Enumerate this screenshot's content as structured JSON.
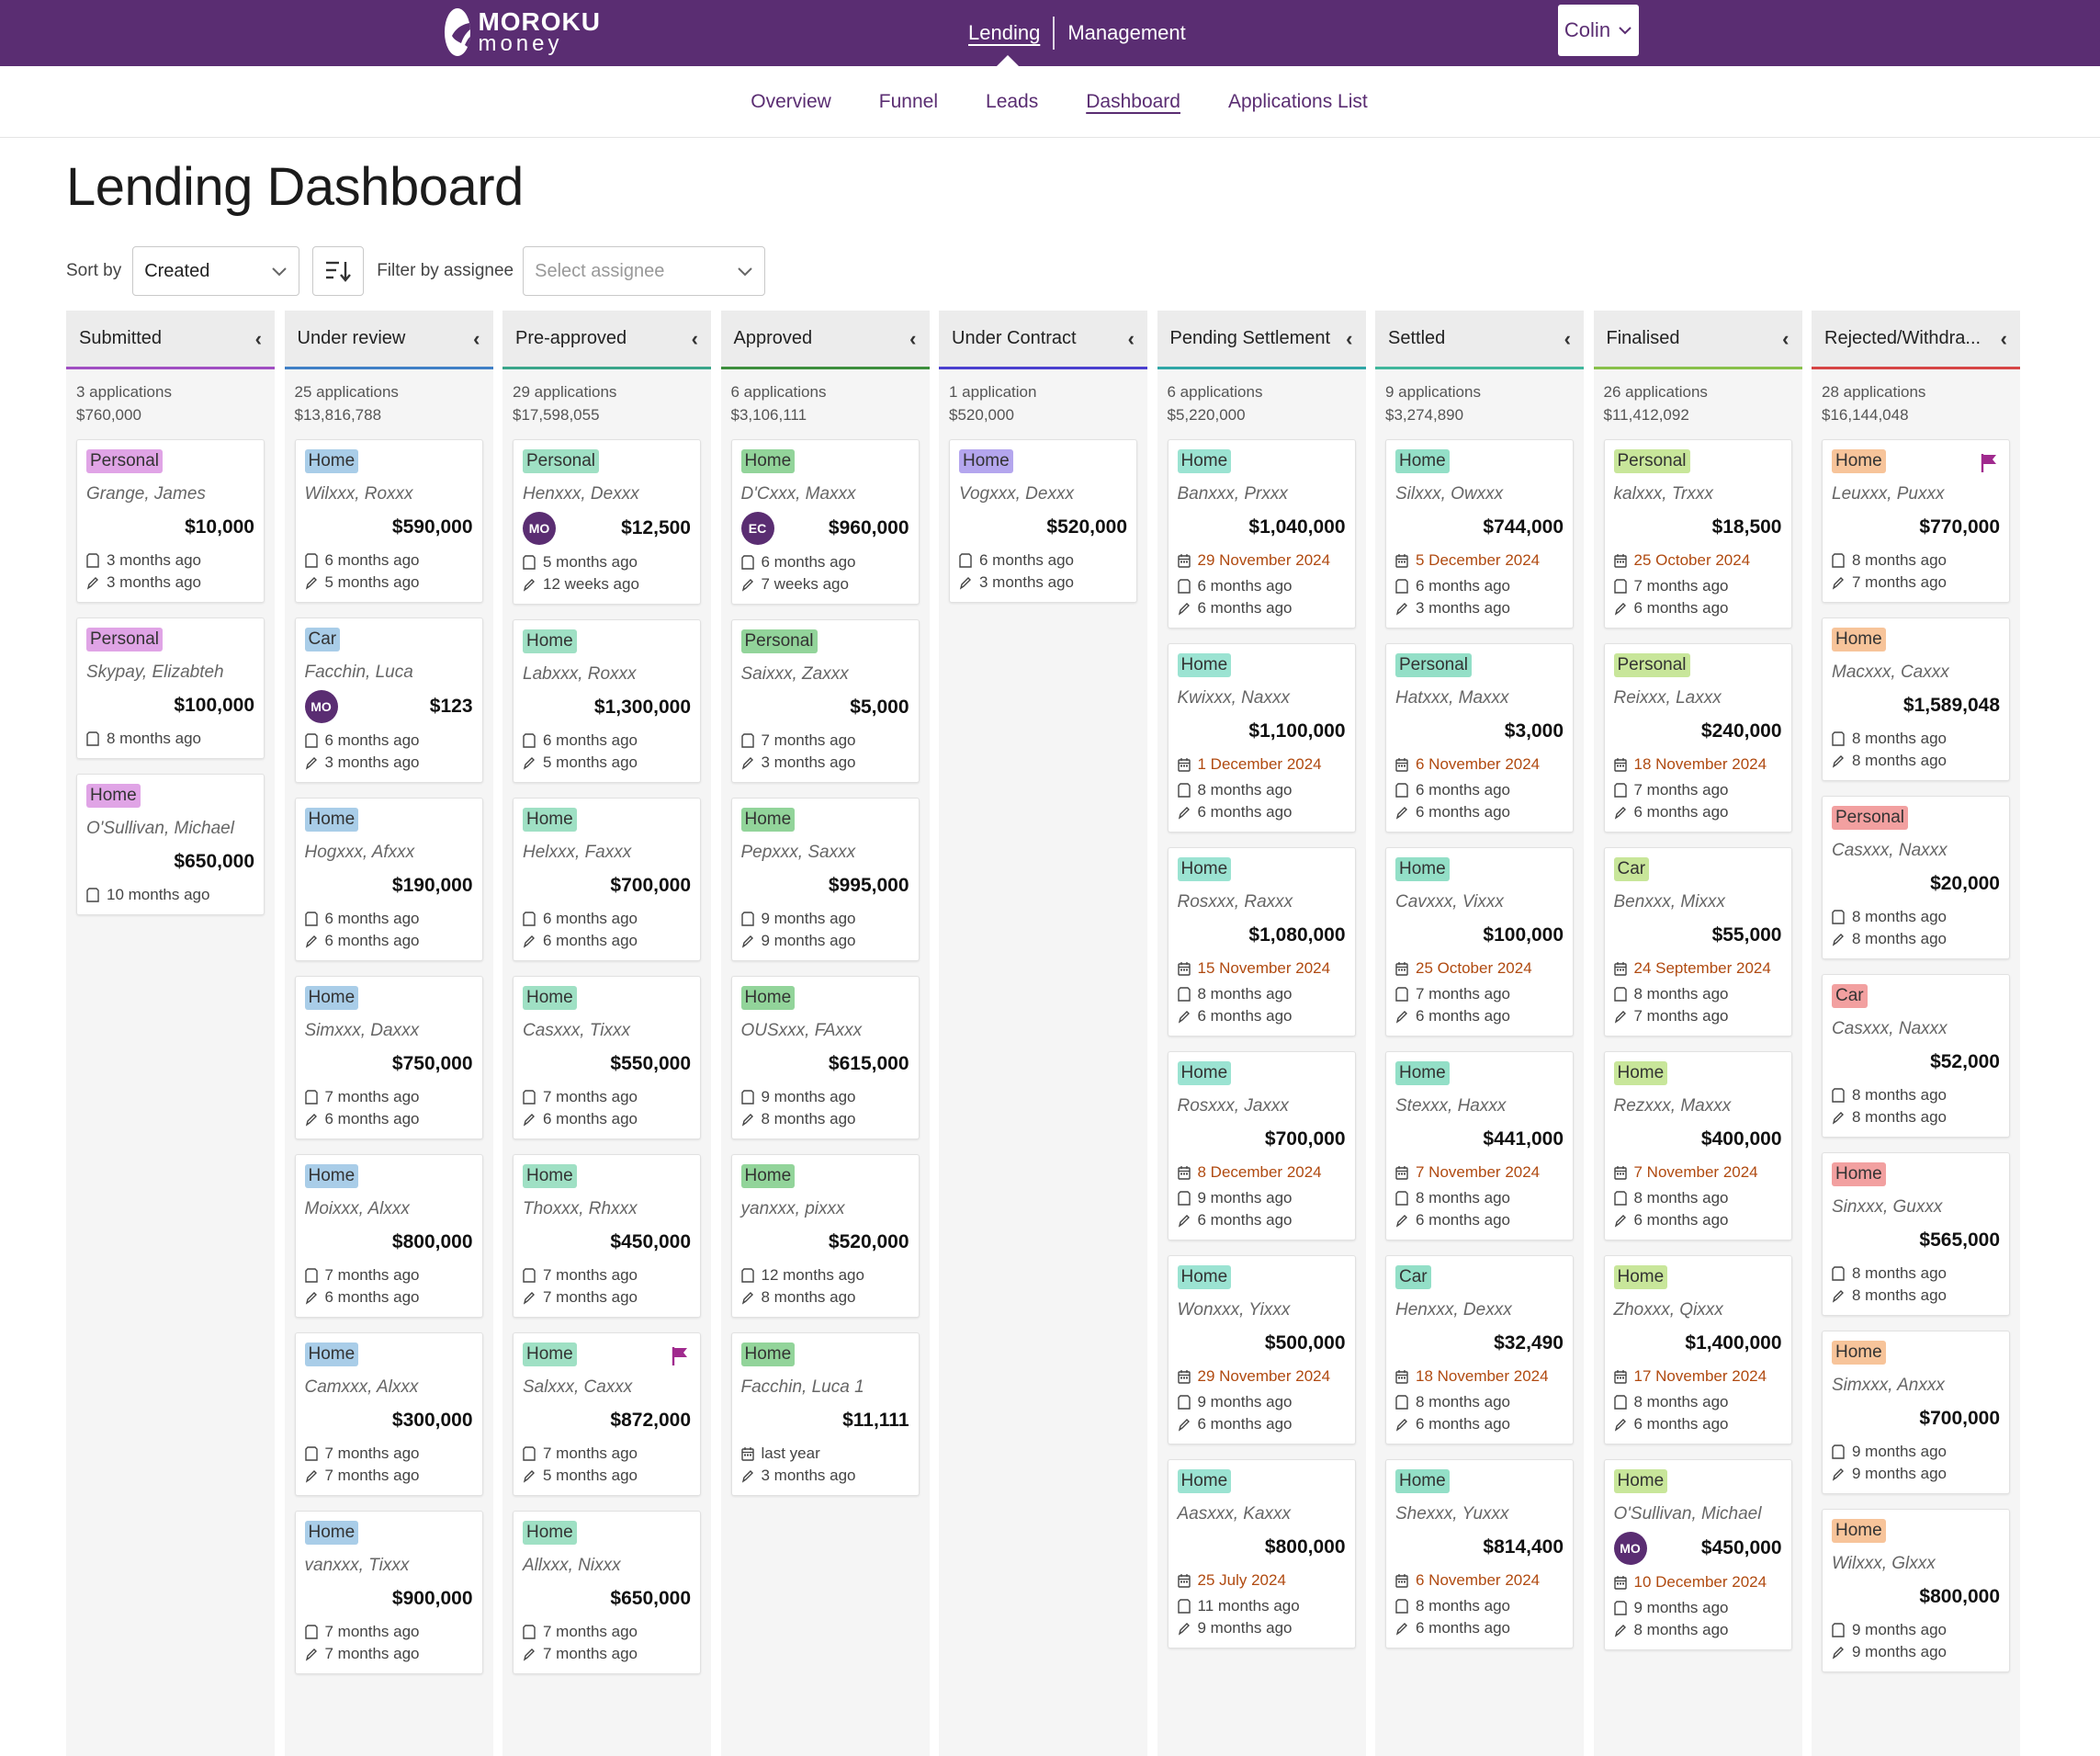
{
  "brand": {
    "line1": "MOROKU",
    "line2": "money"
  },
  "topnav": {
    "lending": "Lending",
    "management": "Management"
  },
  "user": {
    "name": "Colin"
  },
  "subnav": [
    {
      "label": "Overview",
      "active": false
    },
    {
      "label": "Funnel",
      "active": false
    },
    {
      "label": "Leads",
      "active": false
    },
    {
      "label": "Dashboard",
      "active": true
    },
    {
      "label": "Applications List",
      "active": false
    }
  ],
  "page": {
    "title": "Lending Dashboard"
  },
  "controls": {
    "sort_label": "Sort by",
    "sort_value": "Created",
    "filter_label": "Filter by assignee",
    "filter_placeholder": "Select assignee"
  },
  "colors": {
    "brand": "#5a2d72",
    "date_due": "#b04a10"
  },
  "columns": [
    {
      "title": "Submitted",
      "count": "3 applications",
      "total": "$760,000",
      "color": "#a04ec2",
      "cards": [
        {
          "tag": "Personal",
          "tag_color": "#e0a4e6",
          "name": "Grange, James",
          "amount": "$10,000",
          "created": "3 months ago",
          "edited": "3 months ago"
        },
        {
          "tag": "Personal",
          "tag_color": "#e0a4e6",
          "name": "Skypay, Elizabteh",
          "amount": "$100,000",
          "created": "8 months ago"
        },
        {
          "tag": "Home",
          "tag_color": "#e0a4e6",
          "name": "O'Sullivan, Michael",
          "amount": "$650,000",
          "created": "10 months ago"
        }
      ]
    },
    {
      "title": "Under review",
      "count": "25 applications",
      "total": "$13,816,788",
      "color": "#3f7fc6",
      "cards": [
        {
          "tag": "Home",
          "tag_color": "#a9cde8",
          "name": "Wilxxx, Roxxx",
          "amount": "$590,000",
          "created": "6 months ago",
          "edited": "5 months ago"
        },
        {
          "tag": "Car",
          "tag_color": "#a9cde8",
          "name": "Facchin, Luca",
          "avatar": "MO",
          "amount": "$123",
          "created": "6 months ago",
          "edited": "3 months ago"
        },
        {
          "tag": "Home",
          "tag_color": "#a9cde8",
          "name": "Hogxxx, Afxxx",
          "amount": "$190,000",
          "created": "6 months ago",
          "edited": "6 months ago"
        },
        {
          "tag": "Home",
          "tag_color": "#a9cde8",
          "name": "Simxxx, Daxxx",
          "amount": "$750,000",
          "created": "7 months ago",
          "edited": "6 months ago"
        },
        {
          "tag": "Home",
          "tag_color": "#a9cde8",
          "name": "Moixxx, Alxxx",
          "amount": "$800,000",
          "created": "7 months ago",
          "edited": "6 months ago"
        },
        {
          "tag": "Home",
          "tag_color": "#a9cde8",
          "name": "Camxxx, Alxxx",
          "amount": "$300,000",
          "created": "7 months ago",
          "edited": "7 months ago"
        },
        {
          "tag": "Home",
          "tag_color": "#a9cde8",
          "name": "vanxxx, Tixxx",
          "amount": "$900,000",
          "created": "7 months ago",
          "edited": "7 months ago"
        }
      ]
    },
    {
      "title": "Pre-approved",
      "count": "29 applications",
      "total": "$17,598,055",
      "color": "#3aa58a",
      "cards": [
        {
          "tag": "Personal",
          "tag_color": "#9fe0c4",
          "name": "Henxxx, Dexxx",
          "avatar": "MO",
          "amount": "$12,500",
          "created": "5 months ago",
          "edited": "12 weeks ago"
        },
        {
          "tag": "Home",
          "tag_color": "#9fe0c4",
          "name": "Labxxx, Roxxx",
          "amount": "$1,300,000",
          "created": "6 months ago",
          "edited": "5 months ago"
        },
        {
          "tag": "Home",
          "tag_color": "#9fe0c4",
          "name": "Helxxx, Faxxx",
          "amount": "$700,000",
          "created": "6 months ago",
          "edited": "6 months ago"
        },
        {
          "tag": "Home",
          "tag_color": "#9fe0c4",
          "name": "Casxxx, Tixxx",
          "amount": "$550,000",
          "created": "7 months ago",
          "edited": "6 months ago"
        },
        {
          "tag": "Home",
          "tag_color": "#9fe0c4",
          "name": "Thoxxx, Rhxxx",
          "amount": "$450,000",
          "created": "7 months ago",
          "edited": "7 months ago"
        },
        {
          "tag": "Home",
          "tag_color": "#9fe0c4",
          "name": "Salxxx, Caxxx",
          "amount": "$872,000",
          "created": "7 months ago",
          "edited": "5 months ago",
          "flag": true
        },
        {
          "tag": "Home",
          "tag_color": "#9fe0c4",
          "name": "Allxxx, Nixxx",
          "amount": "$650,000",
          "created": "7 months ago",
          "edited": "7 months ago"
        }
      ]
    },
    {
      "title": "Approved",
      "count": "6 applications",
      "total": "$3,106,111",
      "color": "#3c8e3c",
      "cards": [
        {
          "tag": "Home",
          "tag_color": "#92d49a",
          "name": "D'Cxxx, Maxxx",
          "avatar": "EC",
          "amount": "$960,000",
          "created": "6 months ago",
          "edited": "7 weeks ago"
        },
        {
          "tag": "Personal",
          "tag_color": "#92d49a",
          "name": "Saixxx, Zaxxx",
          "amount": "$5,000",
          "created": "7 months ago",
          "edited": "3 months ago"
        },
        {
          "tag": "Home",
          "tag_color": "#92d49a",
          "name": "Pepxxx, Saxxx",
          "amount": "$995,000",
          "created": "9 months ago",
          "edited": "9 months ago"
        },
        {
          "tag": "Home",
          "tag_color": "#92d49a",
          "name": "OUSxxx, FAxxx",
          "amount": "$615,000",
          "created": "9 months ago",
          "edited": "8 months ago"
        },
        {
          "tag": "Home",
          "tag_color": "#92d49a",
          "name": "yanxxx, pixxx",
          "amount": "$520,000",
          "created": "12 months ago",
          "edited": "8 months ago"
        },
        {
          "tag": "Home",
          "tag_color": "#92d49a",
          "name": "Facchin, Luca 1",
          "amount": "$11,111",
          "created": "last year",
          "edited": "3 months ago",
          "created_icon": "calendar"
        }
      ]
    },
    {
      "title": "Under Contract",
      "count": "1 application",
      "total": "$520,000",
      "color": "#4a3fcf",
      "cards": [
        {
          "tag": "Home",
          "tag_color": "#b4a6ee",
          "name": "Vogxxx, Dexxx",
          "amount": "$520,000",
          "created": "6 months ago",
          "edited": "3 months ago"
        }
      ]
    },
    {
      "title": "Pending Settlement",
      "count": "6 applications",
      "total": "$5,220,000",
      "color": "#2fa6a6",
      "cards": [
        {
          "tag": "Home",
          "tag_color": "#9be3d2",
          "name": "Banxxx, Prxxx",
          "amount": "$1,040,000",
          "date": "29 November 2024",
          "created": "6 months ago",
          "edited": "6 months ago"
        },
        {
          "tag": "Home",
          "tag_color": "#9be3d2",
          "name": "Kwixxx, Naxxx",
          "amount": "$1,100,000",
          "date": "1 December 2024",
          "created": "8 months ago",
          "edited": "6 months ago"
        },
        {
          "tag": "Home",
          "tag_color": "#9be3d2",
          "name": "Rosxxx, Raxxx",
          "amount": "$1,080,000",
          "date": "15 November 2024",
          "created": "8 months ago",
          "edited": "6 months ago"
        },
        {
          "tag": "Home",
          "tag_color": "#9be3d2",
          "name": "Rosxxx, Jaxxx",
          "amount": "$700,000",
          "date": "8 December 2024",
          "created": "9 months ago",
          "edited": "6 months ago"
        },
        {
          "tag": "Home",
          "tag_color": "#9be3d2",
          "name": "Wonxxx, Yixxx",
          "amount": "$500,000",
          "date": "29 November 2024",
          "created": "9 months ago",
          "edited": "6 months ago"
        },
        {
          "tag": "Home",
          "tag_color": "#9be3d2",
          "name": "Aasxxx, Kaxxx",
          "amount": "$800,000",
          "date": "25 July 2024",
          "created": "11 months ago",
          "edited": "9 months ago"
        }
      ]
    },
    {
      "title": "Settled",
      "count": "9 applications",
      "total": "$3,274,890",
      "color": "#3fb69b",
      "cards": [
        {
          "tag": "Home",
          "tag_color": "#93dfc7",
          "name": "Silxxx, Owxxx",
          "amount": "$744,000",
          "date": "5 December 2024",
          "created": "6 months ago",
          "edited": "3 months ago"
        },
        {
          "tag": "Personal",
          "tag_color": "#93dfc7",
          "name": "Hatxxx, Maxxx",
          "amount": "$3,000",
          "date": "6 November 2024",
          "created": "6 months ago",
          "edited": "6 months ago"
        },
        {
          "tag": "Home",
          "tag_color": "#93dfc7",
          "name": "Cavxxx, Vixxx",
          "amount": "$100,000",
          "date": "25 October 2024",
          "created": "7 months ago",
          "edited": "6 months ago"
        },
        {
          "tag": "Home",
          "tag_color": "#93dfc7",
          "name": "Stexxx, Haxxx",
          "amount": "$441,000",
          "date": "7 November 2024",
          "created": "8 months ago",
          "edited": "6 months ago"
        },
        {
          "tag": "Car",
          "tag_color": "#93dfc7",
          "name": "Henxxx, Dexxx",
          "amount": "$32,490",
          "date": "18 November 2024",
          "created": "8 months ago",
          "edited": "6 months ago"
        },
        {
          "tag": "Home",
          "tag_color": "#93dfc7",
          "name": "Shexxx, Yuxxx",
          "amount": "$814,400",
          "date": "6 November 2024",
          "created": "8 months ago",
          "edited": "6 months ago"
        }
      ]
    },
    {
      "title": "Finalised",
      "count": "26 applications",
      "total": "$11,412,092",
      "color": "#88c04a",
      "cards": [
        {
          "tag": "Personal",
          "tag_color": "#c8e69a",
          "name": "kalxxx, Trxxx",
          "amount": "$18,500",
          "date": "25 October 2024",
          "created": "7 months ago",
          "edited": "6 months ago"
        },
        {
          "tag": "Personal",
          "tag_color": "#c8e69a",
          "name": "Reixxx, Laxxx",
          "amount": "$240,000",
          "date": "18 November 2024",
          "created": "7 months ago",
          "edited": "6 months ago"
        },
        {
          "tag": "Car",
          "tag_color": "#c8e69a",
          "name": "Benxxx, Mixxx",
          "amount": "$55,000",
          "date": "24 September 2024",
          "created": "8 months ago",
          "edited": "7 months ago"
        },
        {
          "tag": "Home",
          "tag_color": "#c8e69a",
          "name": "Rezxxx, Maxxx",
          "amount": "$400,000",
          "date": "7 November 2024",
          "created": "8 months ago",
          "edited": "6 months ago"
        },
        {
          "tag": "Home",
          "tag_color": "#c8e69a",
          "name": "Zhoxxx, Qixxx",
          "amount": "$1,400,000",
          "date": "17 November 2024",
          "created": "8 months ago",
          "edited": "6 months ago"
        },
        {
          "tag": "Home",
          "tag_color": "#c8e69a",
          "name": "O'Sullivan, Michael",
          "avatar": "MO",
          "amount": "$450,000",
          "date": "10 December 2024",
          "created": "9 months ago",
          "edited": "8 months ago"
        }
      ]
    },
    {
      "title": "Rejected/Withdra...",
      "count": "28 applications",
      "total": "$16,144,048",
      "color": "#d64545",
      "cards": [
        {
          "tag": "Home",
          "tag_color": "#f7c49a",
          "name": "Leuxxx, Puxxx",
          "amount": "$770,000",
          "created": "8 months ago",
          "edited": "7 months ago",
          "flag": true
        },
        {
          "tag": "Home",
          "tag_color": "#f7c49a",
          "name": "Macxxx, Caxxx",
          "amount": "$1,589,048",
          "created": "8 months ago",
          "edited": "8 months ago"
        },
        {
          "tag": "Personal",
          "tag_color": "#f2a0a0",
          "name": "Casxxx, Naxxx",
          "amount": "$20,000",
          "created": "8 months ago",
          "edited": "8 months ago"
        },
        {
          "tag": "Car",
          "tag_color": "#f2a0a0",
          "name": "Casxxx, Naxxx",
          "amount": "$52,000",
          "created": "8 months ago",
          "edited": "8 months ago"
        },
        {
          "tag": "Home",
          "tag_color": "#f2a0a0",
          "name": "Sinxxx, Guxxx",
          "amount": "$565,000",
          "created": "8 months ago",
          "edited": "8 months ago"
        },
        {
          "tag": "Home",
          "tag_color": "#f7c49a",
          "name": "Simxxx, Anxxx",
          "amount": "$700,000",
          "created": "9 months ago",
          "edited": "9 months ago"
        },
        {
          "tag": "Home",
          "tag_color": "#f7c49a",
          "name": "Wilxxx, Glxxx",
          "amount": "$800,000",
          "created": "9 months ago",
          "edited": "9 months ago"
        }
      ]
    }
  ]
}
